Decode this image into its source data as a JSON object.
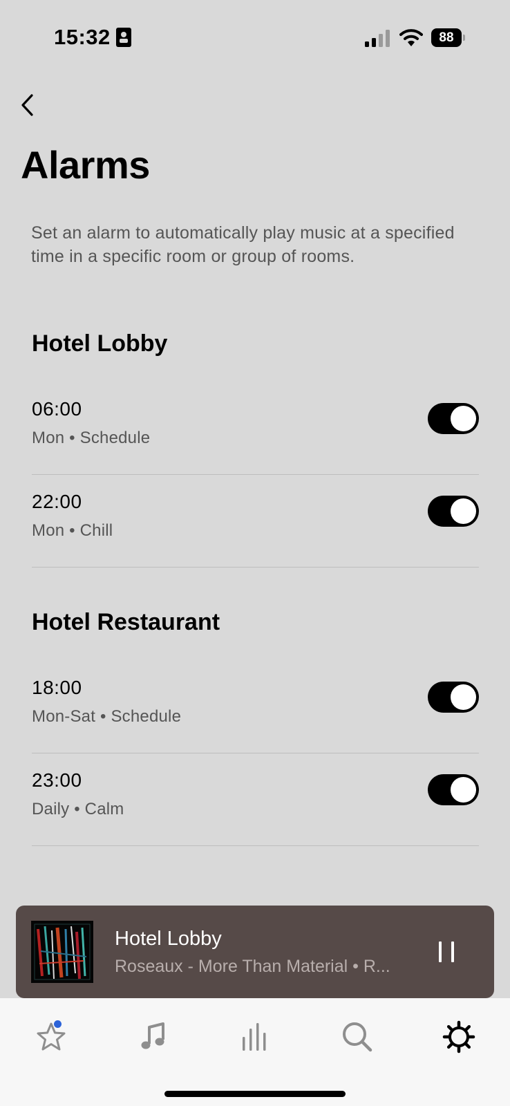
{
  "status_bar": {
    "time": "15:32",
    "battery_level": "88",
    "icons": [
      "id-card-icon",
      "signal-icon",
      "wifi-icon",
      "battery-icon"
    ]
  },
  "header": {
    "back_icon": "chevron-left-icon",
    "title": "Alarms",
    "description": "Set an alarm to automatically play music at a specified time in a specific room or group of rooms."
  },
  "sections": [
    {
      "title": "Hotel Lobby",
      "alarms": [
        {
          "time": "06:00",
          "detail": "Mon • Schedule",
          "enabled": true
        },
        {
          "time": "22:00",
          "detail": "Mon • Chill",
          "enabled": true
        }
      ]
    },
    {
      "title": "Hotel Restaurant",
      "alarms": [
        {
          "time": "18:00",
          "detail": "Mon-Sat • Schedule",
          "enabled": true
        },
        {
          "time": "23:00",
          "detail": "Daily • Calm",
          "enabled": true
        }
      ]
    }
  ],
  "now_playing": {
    "room": "Hotel Lobby",
    "subtitle": "Roseaux - More Than Material • R...",
    "control_icon": "pause-icon"
  },
  "tab_bar": {
    "items": [
      {
        "icon": "star-icon",
        "has_badge": true,
        "badge_color": "#2c63d8"
      },
      {
        "icon": "music-note-icon"
      },
      {
        "icon": "equalizer-icon"
      },
      {
        "icon": "search-icon"
      },
      {
        "icon": "gear-icon",
        "active": true
      }
    ]
  },
  "colors": {
    "background": "#d9d9d9",
    "player_background": "#564a48",
    "toggle_on": "#000000",
    "tab_bar_background": "#f7f7f7"
  }
}
